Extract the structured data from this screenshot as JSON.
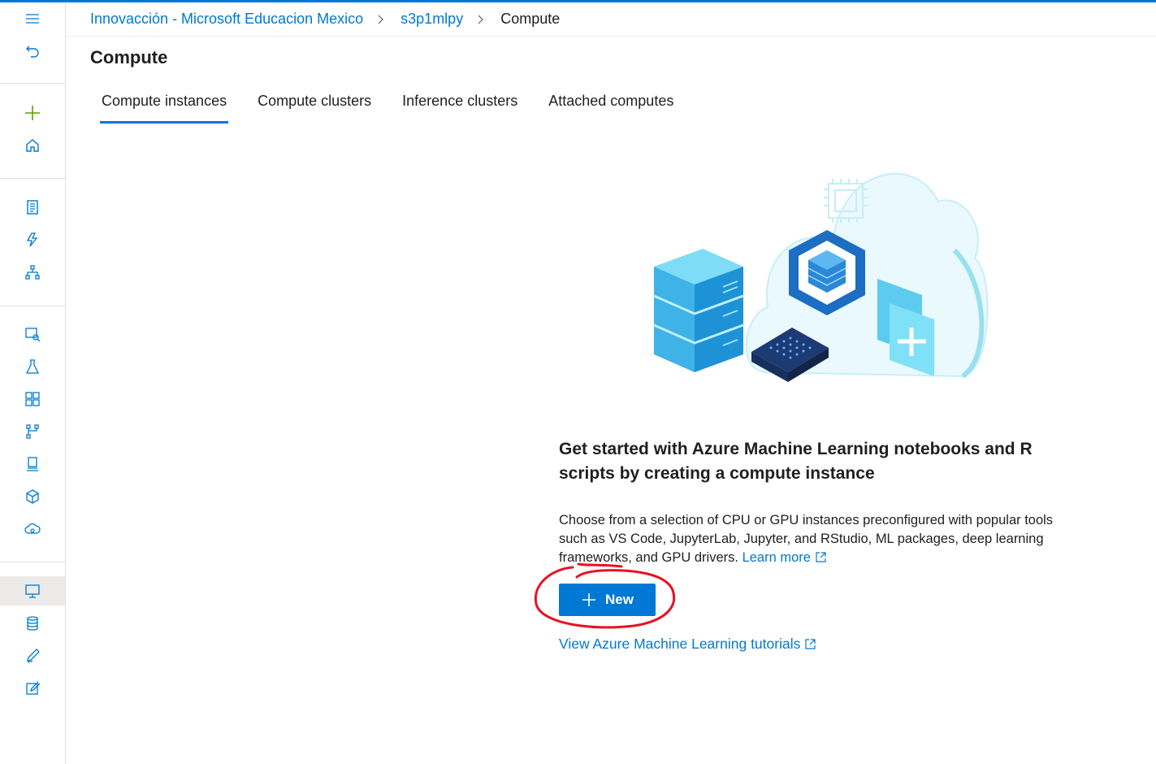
{
  "breadcrumb": {
    "workspace_org": "Innovacción - Microsoft Educacion Mexico",
    "workspace": "s3p1mlpy",
    "current": "Compute"
  },
  "page": {
    "title": "Compute"
  },
  "tabs": [
    {
      "label": "Compute instances",
      "active": true
    },
    {
      "label": "Compute clusters",
      "active": false
    },
    {
      "label": "Inference clusters",
      "active": false
    },
    {
      "label": "Attached computes",
      "active": false
    }
  ],
  "empty_state": {
    "heading": "Get started with Azure Machine Learning notebooks and R scripts by creating a compute instance",
    "description": "Choose from a selection of CPU or GPU instances preconfigured with popular tools such as VS Code, JupyterLab, Jupyter, and RStudio, ML packages, deep learning frameworks, and GPU drivers.",
    "learn_more": "Learn more",
    "new_button": "New",
    "tutorials_link": "View Azure Machine Learning tutorials"
  },
  "rail_icons": [
    "hamburger-icon",
    "back-icon",
    "create-icon",
    "home-icon",
    "notebooks-icon",
    "automl-icon",
    "designer-icon",
    "datasets-icon",
    "experiments-icon",
    "pipelines-icon",
    "models-icon",
    "endpoints-icon",
    "environments-icon",
    "cloud-icon",
    "compute-icon",
    "datastores-icon",
    "data-labeling-icon",
    "linked-services-icon"
  ],
  "colors": {
    "accent": "#0078d4",
    "annotation": "#e81123",
    "text": "#201f1e"
  }
}
